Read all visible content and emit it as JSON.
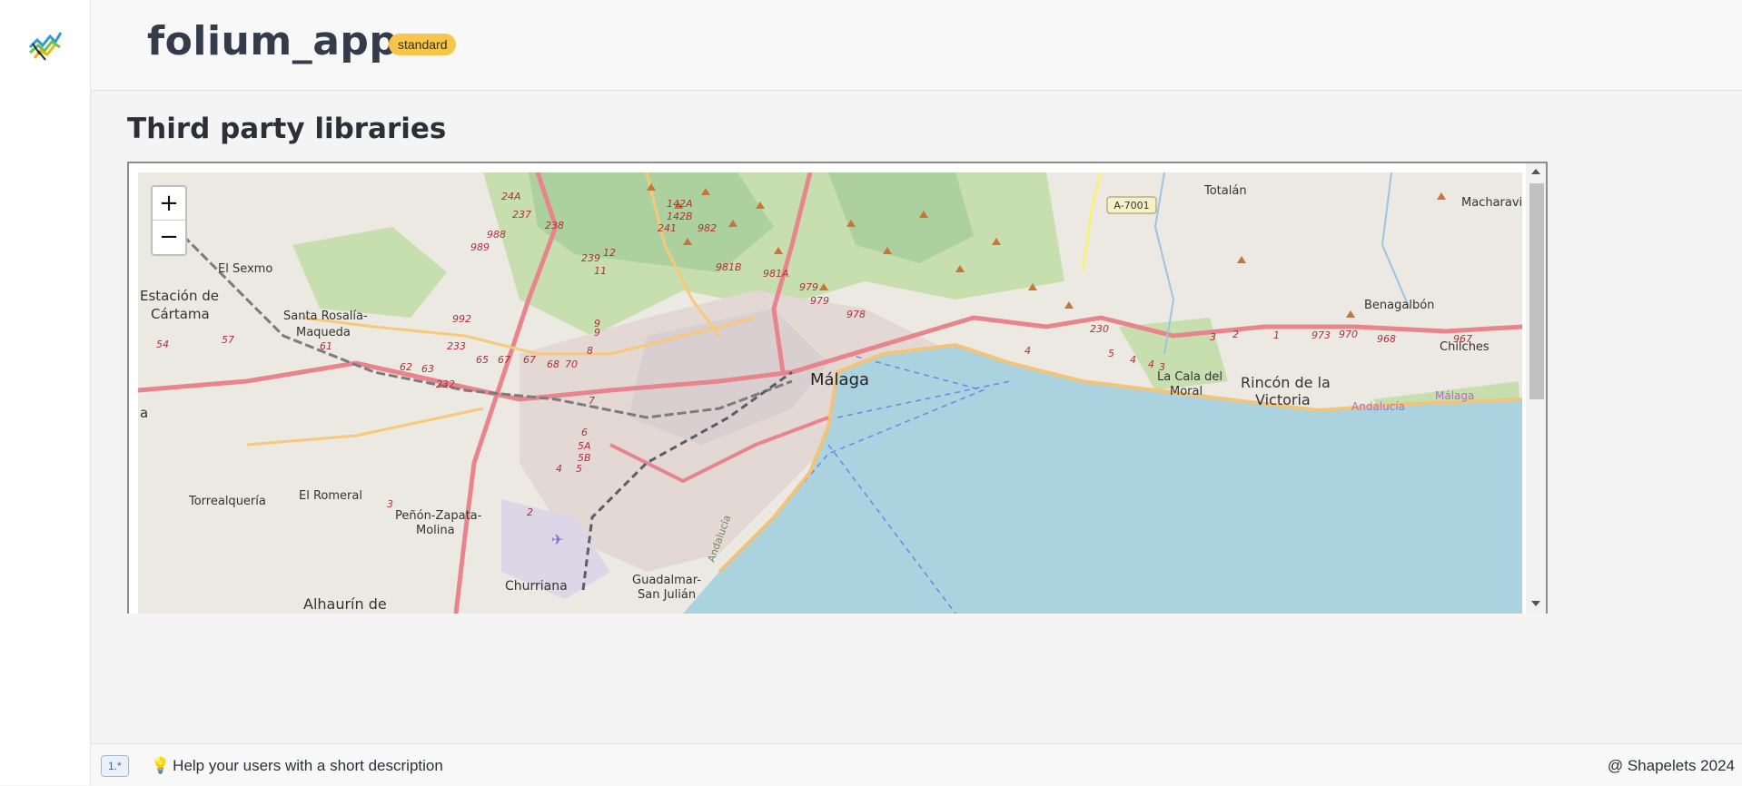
{
  "app": {
    "title": "folium_app",
    "badge": "standard"
  },
  "section": {
    "title": "Third party libraries"
  },
  "map": {
    "zoom_in": "+",
    "zoom_out": "−",
    "labels": {
      "malaga": "Málaga",
      "estacion1": "Estación de",
      "estacion2": "Cártama",
      "el_sexmo": "El Sexmo",
      "santa_rosalia1": "Santa Rosalía-",
      "santa_rosalia2": "Maqueda",
      "el_romeral": "El Romeral",
      "torrealqueria": "Torrealquería",
      "penon1": "Peñón-Zapata-",
      "penon2": "Molina",
      "churriana": "Churriana",
      "guadalmar1": "Guadalmar-",
      "guadalmar2": "San Julián",
      "alhaurin": "Alhaurín de",
      "totalan": "Totalán",
      "macharavia": "Macharavia",
      "benagalbon": "Benagalbón",
      "chilches": "Chilches",
      "la_cala1": "La Cala del",
      "la_cala2": "Moral",
      "rincon1": "Rincón de la",
      "rincon2": "Victoria",
      "andalucia_road": "Andalucía",
      "malaga_road": "Málaga",
      "andalucia_coast": "Andalucía",
      "edge_a": "a",
      "a7001": "A-7001"
    },
    "road_numbers": [
      "24A",
      "237",
      "238",
      "988",
      "989",
      "239",
      "12",
      "11",
      "142A",
      "142B",
      "241",
      "982",
      "981B",
      "981A",
      "979",
      "979",
      "978",
      "992",
      "233",
      "232",
      "65",
      "67",
      "67",
      "68",
      "70",
      "8",
      "9",
      "9",
      "61",
      "62",
      "63",
      "57",
      "54",
      "4",
      "7",
      "6",
      "5A",
      "5B",
      "5",
      "4",
      "3",
      "2",
      "230",
      "5",
      "4",
      "4",
      "3",
      "3",
      "2",
      "1",
      "973",
      "970",
      "968",
      "967",
      "967"
    ]
  },
  "footer": {
    "version": "1.*",
    "help": "Help your users with a short description",
    "copyright": "@ Shapelets 2024"
  },
  "colors": {
    "badge": "#f6c64a",
    "sea": "#aad3df",
    "road_primary": "#e8848c",
    "road_secondary": "#f7c97a"
  }
}
